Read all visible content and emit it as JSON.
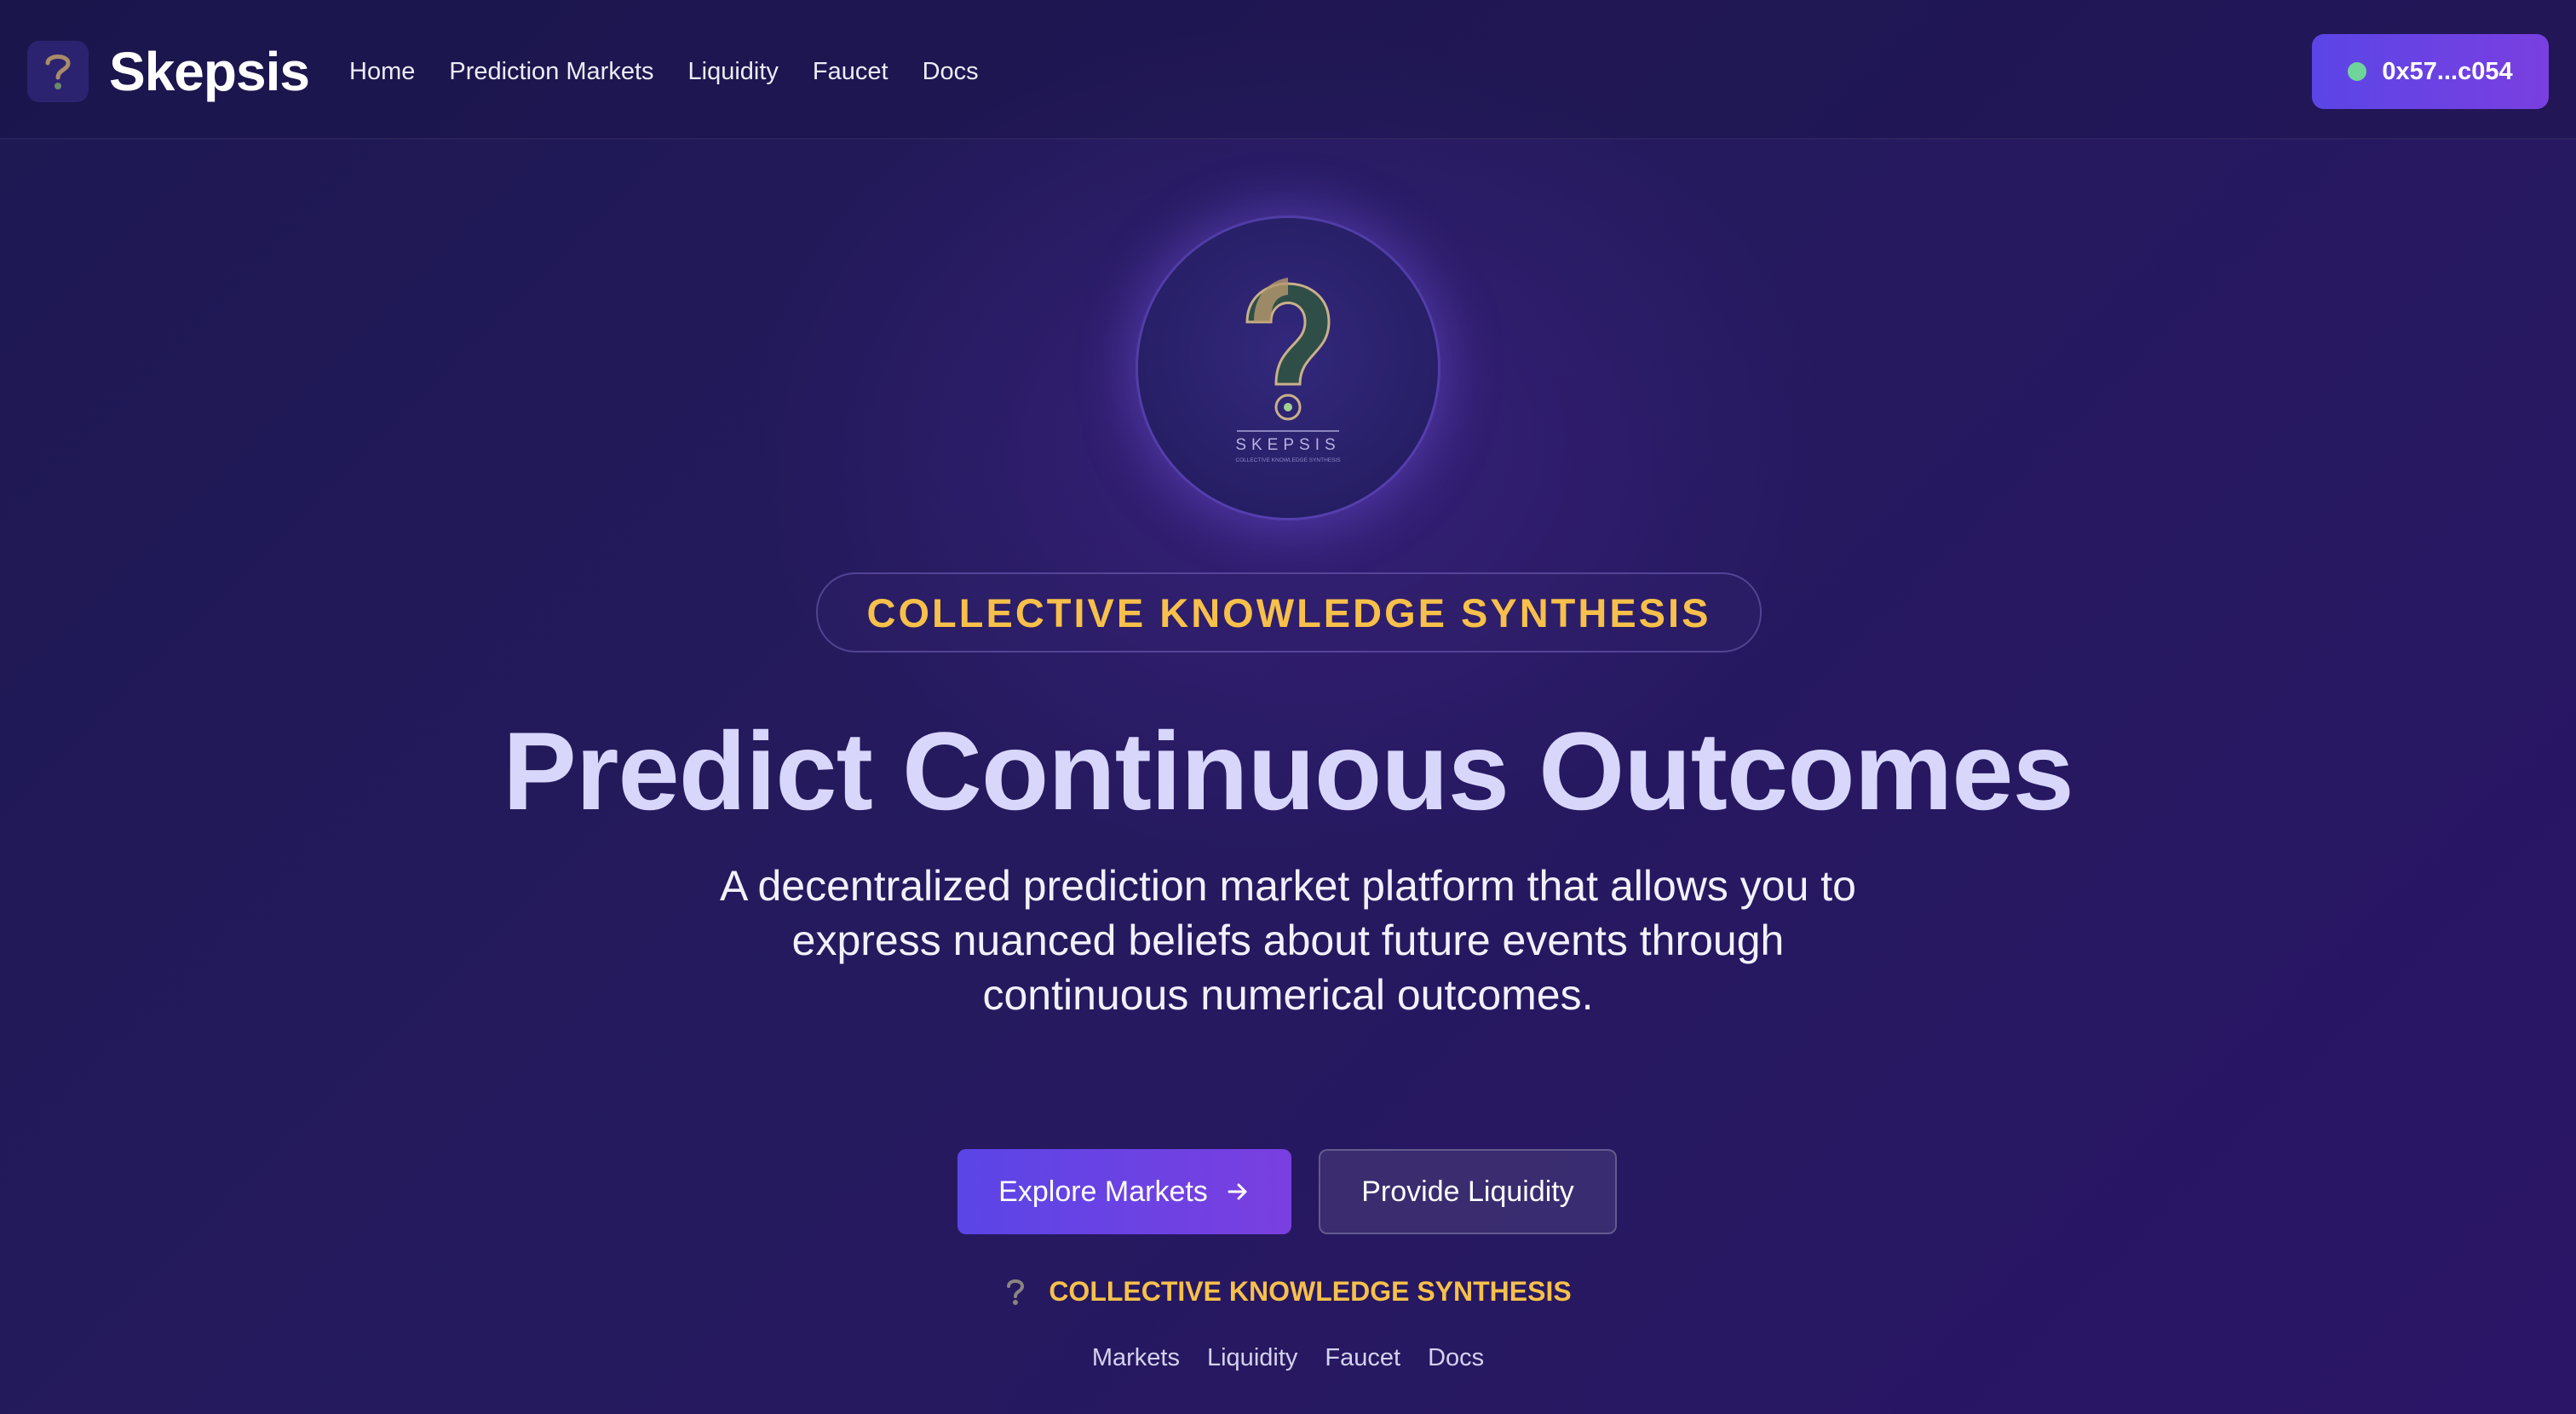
{
  "header": {
    "brand": "Skepsis",
    "nav": [
      "Home",
      "Prediction Markets",
      "Liquidity",
      "Faucet",
      "Docs"
    ],
    "wallet_address": "0x57...c054"
  },
  "hero": {
    "logo_word": "SKEPSIS",
    "logo_caption": "COLLECTIVE KNOWLEDGE SYNTHESIS",
    "tagline": "COLLECTIVE KNOWLEDGE SYNTHESIS",
    "headline": "Predict Continuous Outcomes",
    "subtitle": "A decentralized prediction market platform that allows you to express nuanced beliefs about future events through continuous numerical outcomes.",
    "primary_button": "Explore Markets",
    "secondary_button": "Provide Liquidity"
  },
  "footer": {
    "tagline": "COLLECTIVE KNOWLEDGE SYNTHESIS",
    "links": [
      "Markets",
      "Liquidity",
      "Faucet",
      "Docs"
    ]
  },
  "colors": {
    "accent": "#6a45e6",
    "gold": "#f7c04a",
    "status_online": "#6fd49a"
  }
}
